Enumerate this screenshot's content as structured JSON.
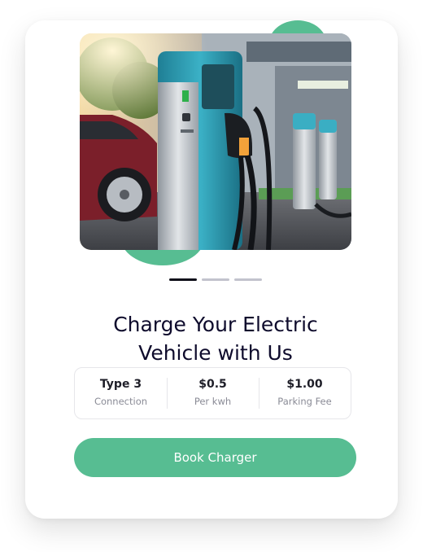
{
  "hero": {
    "image_subject": "electric vehicle charging station with red car",
    "carousel": {
      "total": 3,
      "active": 1
    }
  },
  "title": {
    "line1": "Charge Your Electric",
    "line2": "Vehicle with Us"
  },
  "stats": [
    {
      "value": "Type 3",
      "label": "Connection"
    },
    {
      "value": "$0.5",
      "label": "Per kwh"
    },
    {
      "value": "$1.00",
      "label": "Parking Fee"
    }
  ],
  "cta": {
    "label": "Book Charger"
  },
  "colors": {
    "accent": "#57bd92",
    "title": "#0e0b2c",
    "muted": "#8a8b96",
    "dot_active": "#0f0f1a",
    "dot_inactive": "#c2c3cd"
  }
}
